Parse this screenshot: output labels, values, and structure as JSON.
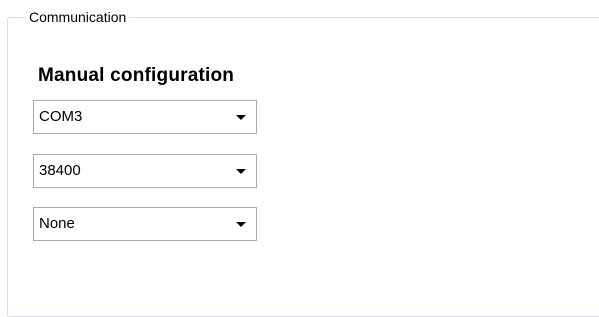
{
  "group": {
    "title": "Communication"
  },
  "manual": {
    "heading": "Manual configuration",
    "port": {
      "selected": "COM3"
    },
    "baud_rate": {
      "selected": "38400"
    },
    "parity": {
      "selected": "None"
    }
  },
  "icons": {
    "dropdown": "chevron-down-icon"
  },
  "colors": {
    "groupbox_border": "#d5dfe5",
    "combo_border": "#a9a9a9"
  }
}
